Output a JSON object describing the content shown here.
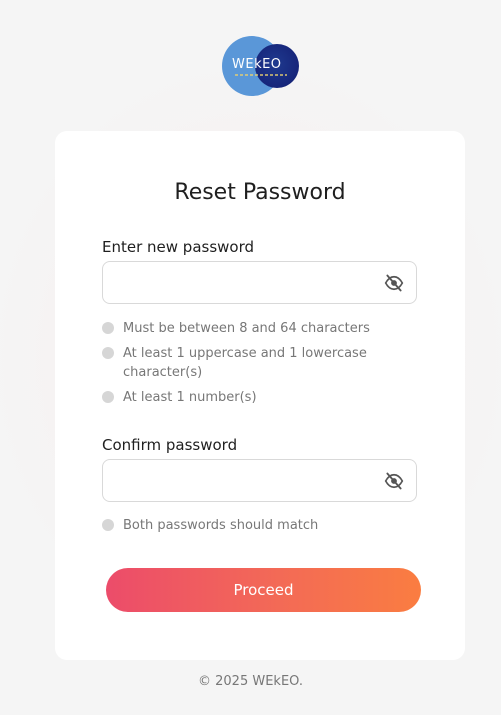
{
  "brand": {
    "logo_text": "WEkEO",
    "logo_colors": [
      "#5a97d8",
      "#16257a"
    ]
  },
  "form": {
    "title": "Reset Password",
    "new_password": {
      "label": "Enter new password",
      "value": "",
      "icon": "eye-off-icon"
    },
    "rules": [
      "Must be between 8 and 64 characters",
      "At least 1 uppercase and 1 lowercase character(s)",
      "At least 1 number(s)"
    ],
    "confirm_password": {
      "label": "Confirm password",
      "value": "",
      "icon": "eye-off-icon"
    },
    "match_rule": "Both passwords should match",
    "submit_label": "Proceed",
    "button_gradient": [
      "#ec4c6a",
      "#fa7d41"
    ]
  },
  "footer": {
    "copyright": "© 2025 WEkEO."
  }
}
